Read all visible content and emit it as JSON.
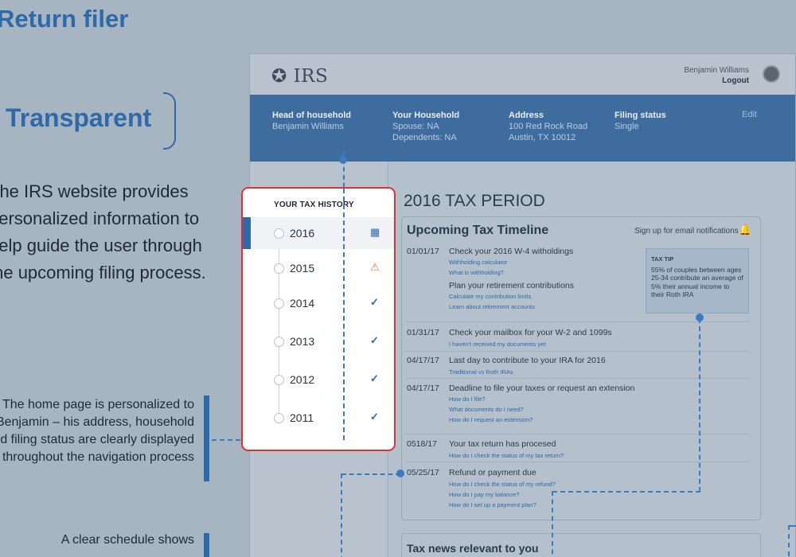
{
  "presentation": {
    "title": "Return filer",
    "subtitle": "Transparent",
    "paragraph": "The IRS website provides personalized information to help guide the user through the upcoming filing process.",
    "note1": "The home page is personalized to Benjamin – his address, household and filing status are clearly displayed throughout the navigation process",
    "note2": "A clear schedule shows"
  },
  "header": {
    "logo": "IRS",
    "user_name": "Benjamin Williams",
    "logout": "Logout"
  },
  "household": {
    "filing_type": {
      "heading": "Head of household",
      "value": "Benjamin Williams"
    },
    "your_household": {
      "heading": "Your Household",
      "line1": "Spouse: NA",
      "line2": "Dependents: NA"
    },
    "address": {
      "heading": "Address",
      "line1": "100 Red Rock Road",
      "line2": "Austin, TX 10012"
    },
    "filing_status": {
      "heading": "Filing status",
      "value": "Single"
    },
    "edit": "Edit"
  },
  "tax_history": {
    "heading": "YOUR TAX HISTORY",
    "years": [
      {
        "year": "2016",
        "status": "calendar-icon"
      },
      {
        "year": "2015",
        "status": "warning-icon"
      },
      {
        "year": "2014",
        "status": "check-icon"
      },
      {
        "year": "2013",
        "status": "check-icon"
      },
      {
        "year": "2012",
        "status": "check-icon"
      },
      {
        "year": "2011",
        "status": "check-icon"
      }
    ]
  },
  "main": {
    "period_title": "2016 TAX PERIOD",
    "timeline_title": "Upcoming Tax Timeline",
    "signup": "Sign up for email notifications",
    "events": [
      {
        "date": "01/01/17",
        "title": "Check your 2016 W-4 witholdings",
        "links": [
          "Withholding calculator",
          "What is withholding?"
        ],
        "title2": "Plan your retirement contributions",
        "links2": [
          "Calculate my contribution limits",
          "Learn about retirement accounts"
        ]
      },
      {
        "date": "01/31/17",
        "title": "Check your mailbox for your W-2 and 1099s",
        "links": [
          "I haven't received my documents yet"
        ]
      },
      {
        "date": "04/17/17",
        "title": "Last day to contribute to your IRA for 2016",
        "links": [
          "Traditional vs Roth IRAs"
        ]
      },
      {
        "date": "04/17/17",
        "title": "Deadline to file your taxes or request an extension",
        "links": [
          "How do I file?",
          "What documents do I need?",
          "How do I request an extension?"
        ]
      },
      {
        "date": "0518/17",
        "title": "Your tax return has procesed",
        "links": [
          "How do I check the status of my tax return?"
        ]
      },
      {
        "date": "05/25/17",
        "title": "Refund or payment due",
        "links": [
          "How do I check the status of my refund?",
          "How do I pay my balance?",
          "How do I set up a payment plan?"
        ]
      }
    ],
    "tip": {
      "heading": "TAX TIP",
      "text": "55% of couples between ages 25-34 contribute an average of 5% their annual income to their Roth IRA"
    },
    "news_title": "Tax news relevant to you"
  },
  "colors": {
    "accent": "#2e6aa7",
    "household_bar": "#3f6c9e",
    "highlight_border": "#dd3333",
    "warning": "#e07b2f"
  }
}
